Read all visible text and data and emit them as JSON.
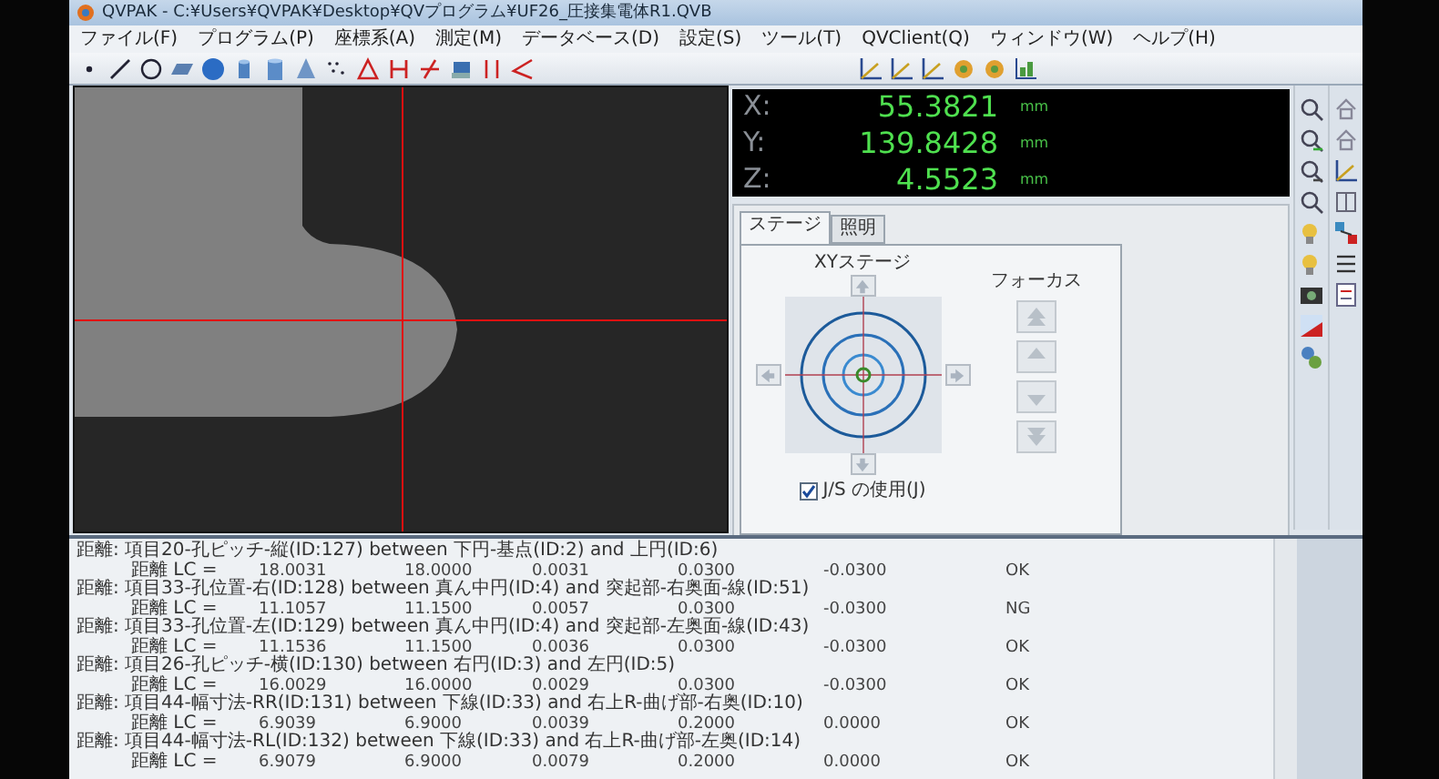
{
  "window": {
    "title": "QVPAK - C:¥Users¥QVPAK¥Desktop¥QVプログラム¥UF26_圧接集電体R1.QVB"
  },
  "menu": [
    "ファイル(F)",
    "プログラム(P)",
    "座標系(A)",
    "測定(M)",
    "データベース(D)",
    "設定(S)",
    "ツール(T)",
    "QVClient(Q)",
    "ウィンドウ(W)",
    "ヘルプ(H)"
  ],
  "dro": {
    "axes": [
      {
        "label": "X:",
        "value": "55.3821",
        "unit": "mm"
      },
      {
        "label": "Y:",
        "value": "139.8428",
        "unit": "mm"
      },
      {
        "label": "Z:",
        "value": "4.5523",
        "unit": "mm"
      }
    ]
  },
  "stage_panel": {
    "tabs": [
      {
        "label": "ステージ",
        "selected": true
      },
      {
        "label": "照明",
        "selected": false
      }
    ],
    "xy_label": "XYステージ",
    "focus_label": "フォーカス",
    "joystick": {
      "label": "J/S の使用(J)",
      "checked": true
    }
  },
  "report": {
    "entries": [
      {
        "title": "距離: 項目20-孔ピッチ-縦(ID:127) between 下円-基点(ID:2) and 上円(ID:6)",
        "label": "距離 LC =",
        "values": [
          "18.0031",
          "18.0000",
          "0.0031",
          "0.0300",
          "-0.0300"
        ],
        "result": "OK"
      },
      {
        "title": "距離: 項目33-孔位置-右(ID:128) between 真ん中円(ID:4) and 突起部-右奥面-線(ID:51)",
        "label": "距離 LC =",
        "values": [
          "11.1057",
          "11.1500",
          "0.0057",
          "0.0300",
          "-0.0300"
        ],
        "result": "NG"
      },
      {
        "title": "距離: 項目33-孔位置-左(ID:129) between 真ん中円(ID:4) and 突起部-左奥面-線(ID:43)",
        "label": "距離 LC =",
        "values": [
          "11.1536",
          "11.1500",
          "0.0036",
          "0.0300",
          "-0.0300"
        ],
        "result": "OK"
      },
      {
        "title": "距離: 項目26-孔ピッチ-横(ID:130) between 右円(ID:3) and 左円(ID:5)",
        "label": "距離 LC =",
        "values": [
          "16.0029",
          "16.0000",
          "0.0029",
          "0.0300",
          "-0.0300"
        ],
        "result": "OK"
      },
      {
        "title": "距離: 項目44-幅寸法-RR(ID:131) between 下線(ID:33) and 右上R-曲げ部-右奥(ID:10)",
        "label": "距離 LC =",
        "values": [
          "6.9039",
          "6.9000",
          "0.0039",
          "0.2000",
          "0.0000"
        ],
        "result": "OK"
      },
      {
        "title": "距離: 項目44-幅寸法-RL(ID:132) between 下線(ID:33) and 右上R-曲げ部-左奥(ID:14)",
        "label": "距離 LC =",
        "values": [
          "6.9079",
          "6.9000",
          "0.0079",
          "0.2000",
          "0.0000"
        ],
        "result": "OK"
      }
    ]
  }
}
